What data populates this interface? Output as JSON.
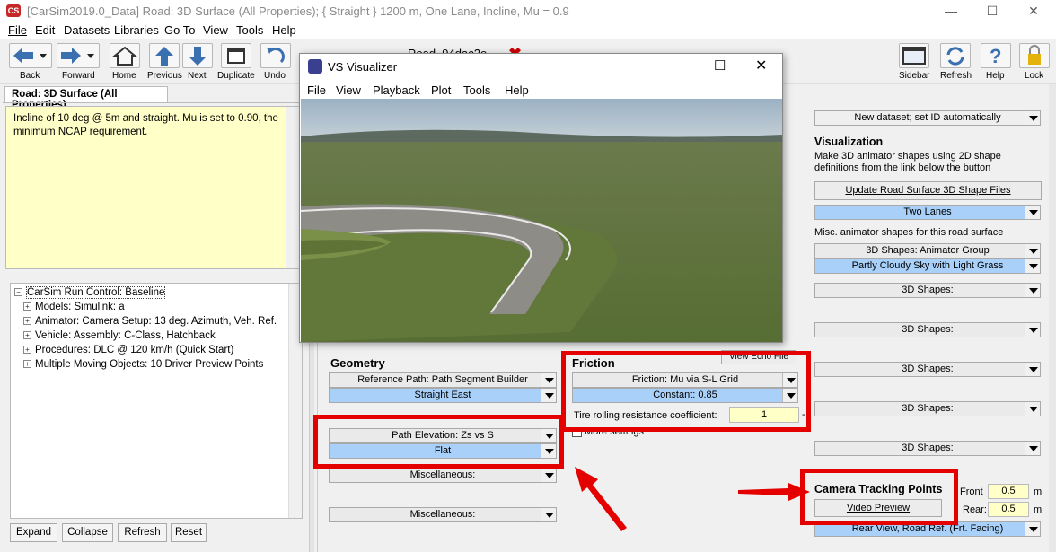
{
  "window": {
    "title": "[CarSim2019.0_Data] Road: 3D Surface (All Properties); { Straight } 1200 m, One Lane, Incline, Mu = 0.9",
    "app_icon_text": "CS"
  },
  "menu": [
    "File",
    "Edit",
    "Datasets",
    "Libraries",
    "Go To",
    "View",
    "Tools",
    "Help"
  ],
  "toolbar": {
    "back": "Back",
    "forward": "Forward",
    "home": "Home",
    "previous": "Previous",
    "next": "Next",
    "duplicate": "Duplicate",
    "undo": "Undo",
    "dataset_name": "Road_94dac2e",
    "sidebar": "Sidebar",
    "refresh": "Refresh",
    "help": "Help",
    "lock": "Lock"
  },
  "tab": {
    "label": "Road: 3D Surface (All Properties)"
  },
  "notes": "Incline of 10 deg @ 5m and straight. Mu is set to  0.90, the minimum NCAP requirement.",
  "tree": {
    "root": "CarSim Run Control: Baseline",
    "items": [
      "Models: Simulink: a",
      "Animator: Camera Setup: 13 deg. Azimuth, Veh. Ref.",
      "Vehicle: Assembly: C-Class, Hatchback",
      "Procedures: DLC @ 120 km/h (Quick Start)",
      "Multiple Moving Objects: 10 Driver Preview Points"
    ]
  },
  "bottom_buttons": {
    "expand": "Expand",
    "collapse": "Collapse",
    "refresh": "Refresh",
    "reset": "Reset"
  },
  "visualizer": {
    "title": "VS Visualizer",
    "menu": [
      "File",
      "View",
      "Playback",
      "Plot",
      "Tools",
      "Help"
    ]
  },
  "geometry": {
    "title": "Geometry",
    "ref_path": "Reference Path: Path Segment Builder",
    "ref_path_value": "Straight East",
    "elevation": "Path Elevation: Zs vs S",
    "elevation_value": "Flat",
    "misc1": "Miscellaneous:",
    "misc2": "Miscellaneous:"
  },
  "friction": {
    "title": "Friction",
    "mu": "Friction: Mu via S-L Grid",
    "mu_value": "Constant: 0.85",
    "trr_label": "Tire rolling resistance coefficient:",
    "trr_value": "1",
    "more_settings": "More settings",
    "view_echo": "View Echo File"
  },
  "right": {
    "new_dataset": "New dataset; set ID automatically",
    "vis_title": "Visualization",
    "vis_desc": "Make 3D animator shapes using 2D shape definitions from the link below the button",
    "update_btn": "Update Road Surface 3D Shape Files",
    "two_lanes": "Two Lanes",
    "misc_shapes": "Misc. animator shapes for this road surface",
    "shapes_group": "3D Shapes: Animator Group",
    "sky": "Partly Cloudy Sky with Light Grass",
    "shapes": [
      "3D Shapes:",
      "3D Shapes:",
      "3D Shapes:",
      "3D Shapes:",
      "3D Shapes:"
    ],
    "camera_title": "Camera Tracking Points",
    "video_preview": "Video Preview",
    "front_label": "Front",
    "front_value": "0.5",
    "front_unit": "m",
    "rear_label": "Rear:",
    "rear_value": "0.5",
    "rear_unit": "m",
    "rear_view": "Rear View, Road Ref. (Frt. Facing)"
  },
  "colors": {
    "highlight": "#e50000",
    "field_blue": "#a8d0f8",
    "notes_yellow": "#ffffc8"
  }
}
